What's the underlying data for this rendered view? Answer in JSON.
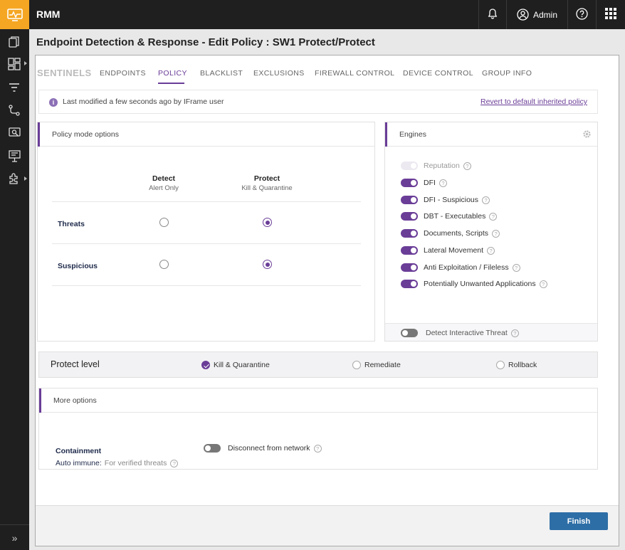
{
  "app": {
    "title": "RMM"
  },
  "topbar": {
    "admin_label": "Admin"
  },
  "page": {
    "title": "Endpoint Detection & Response - Edit Policy : SW1 Protect/Protect"
  },
  "tabs": [
    {
      "label": "SENTINELS"
    },
    {
      "label": "ENDPOINTS"
    },
    {
      "label": "POLICY"
    },
    {
      "label": "BLACKLIST"
    },
    {
      "label": "EXCLUSIONS"
    },
    {
      "label": "FIREWALL CONTROL"
    },
    {
      "label": "DEVICE CONTROL"
    },
    {
      "label": "GROUP INFO"
    }
  ],
  "active_tab": "POLICY",
  "notice": {
    "info_icon": "i",
    "message": "Last modified a few seconds ago by IFrame user",
    "revert_link": "Revert to default inherited policy"
  },
  "policy_mode": {
    "title": "Policy mode options",
    "columns": [
      {
        "heading": "Detect",
        "sub": "Alert Only"
      },
      {
        "heading": "Protect",
        "sub": "Kill & Quarantine"
      }
    ],
    "rows": [
      {
        "label": "Threats",
        "selected": "Protect"
      },
      {
        "label": "Suspicious",
        "selected": "Protect"
      }
    ]
  },
  "engines": {
    "title": "Engines",
    "help_glyph": "?",
    "items": [
      {
        "label": "Reputation",
        "state": "disabled"
      },
      {
        "label": "DFI",
        "state": "on"
      },
      {
        "label": "DFI - Suspicious",
        "state": "on"
      },
      {
        "label": "DBT - Executables",
        "state": "on"
      },
      {
        "label": "Documents, Scripts",
        "state": "on"
      },
      {
        "label": "Lateral Movement",
        "state": "on"
      },
      {
        "label": "Anti Exploitation / Fileless",
        "state": "on"
      },
      {
        "label": "Potentially Unwanted Applications",
        "state": "on"
      }
    ],
    "footer_item": {
      "label": "Detect Interactive Threat",
      "state": "off"
    }
  },
  "protect_level": {
    "label": "Protect level",
    "options": [
      {
        "label": "Kill & Quarantine",
        "selected": true
      },
      {
        "label": "Remediate",
        "selected": false
      },
      {
        "label": "Rollback",
        "selected": false
      }
    ]
  },
  "more_options": {
    "title": "More options",
    "containment_label": "Containment",
    "auto_immune_label": "Auto immune:",
    "auto_immune_value": "For verified threats",
    "disconnect_label": "Disconnect from network",
    "disconnect_state": "off"
  },
  "footer": {
    "finish_label": "Finish"
  },
  "colors": {
    "accent": "#6a3d97",
    "topbar": "#1f1f1f",
    "logo": "#f5a623",
    "finish": "#2e6ea6"
  }
}
